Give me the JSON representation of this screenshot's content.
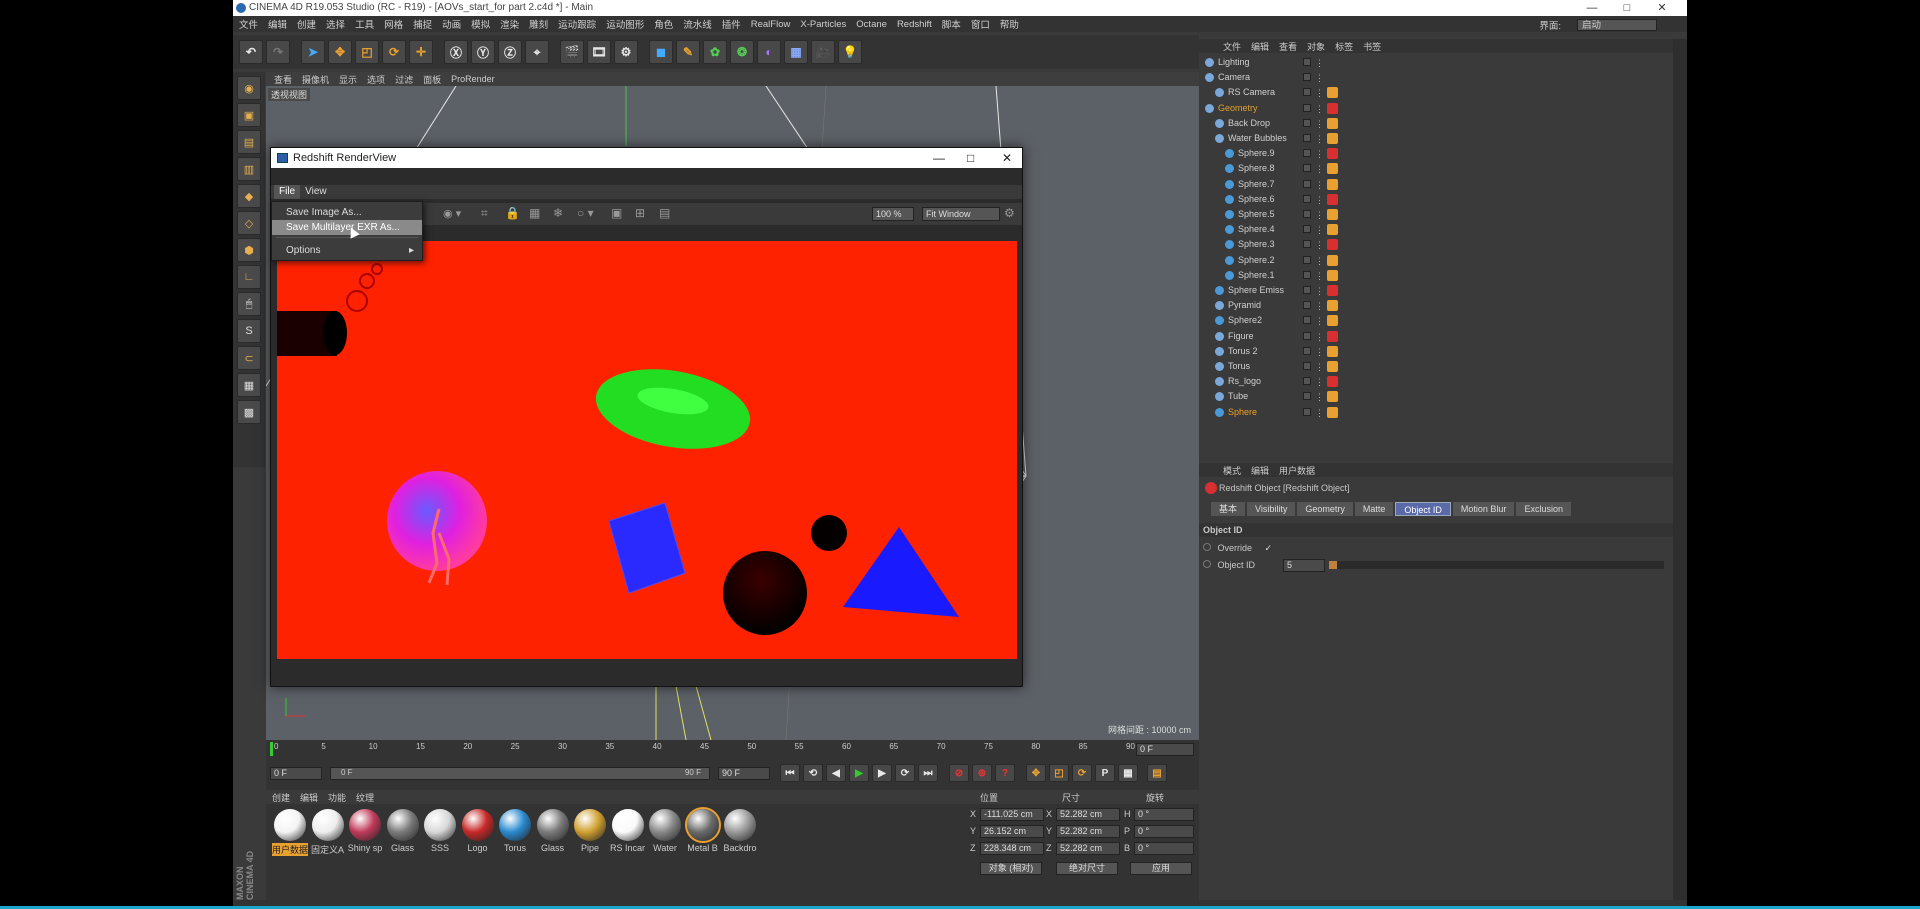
{
  "window": {
    "title": "CINEMA 4D R19.053 Studio (RC - R19) - [AOVs_start_for part 2.c4d *] - Main",
    "controls": [
      "—",
      "□",
      "✕"
    ]
  },
  "menubar": {
    "items": [
      "文件",
      "编辑",
      "创建",
      "选择",
      "工具",
      "网格",
      "捕捉",
      "动画",
      "模拟",
      "渲染",
      "雕刻",
      "运动跟踪",
      "运动图形",
      "角色",
      "流水线",
      "插件",
      "RealFlow",
      "X-Particles",
      "Octane",
      "Redshift",
      "脚本",
      "窗口",
      "帮助"
    ],
    "layout_label": "界面:",
    "layout_value": "启动"
  },
  "viewport": {
    "menu": [
      "查看",
      "摄像机",
      "显示",
      "选项",
      "过滤",
      "面板",
      "ProRender"
    ],
    "label": "透视视图",
    "grid_info": "网格间距 : 10000 cm"
  },
  "renderview": {
    "title": "Redshift RenderView",
    "menu": [
      "File",
      "View"
    ],
    "zoom": "100 %",
    "fit": "Fit Window",
    "file_menu": {
      "items": [
        "Save Image As...",
        "Save Multilayer EXR As...",
        "Options"
      ],
      "highlighted": "Save Multilayer EXR As...",
      "options_arrow": "▸"
    }
  },
  "timeline": {
    "ticks": [
      "0",
      "5",
      "10",
      "15",
      "20",
      "25",
      "30",
      "35",
      "40",
      "45",
      "50",
      "55",
      "60",
      "65",
      "70",
      "75",
      "80",
      "85",
      "90"
    ],
    "current_frame": "0 F",
    "start": "0 F",
    "range_start": "0 F",
    "range_end": "90 F",
    "end": "90 F"
  },
  "materials": {
    "tabs": [
      "创建",
      "编辑",
      "功能",
      "纹理"
    ],
    "items": [
      {
        "label": "用户数据",
        "color": "#f4f4f4"
      },
      {
        "label": "固定义A",
        "color": "#eeeeee"
      },
      {
        "label": "Shiny sp",
        "color": "#c03a5a"
      },
      {
        "label": "Glass",
        "color": "#7a7a7a"
      },
      {
        "label": "SSS",
        "color": "#d8d8d8"
      },
      {
        "label": "Logo",
        "color": "#c82828"
      },
      {
        "label": "Torus",
        "color": "#2a8ad0"
      },
      {
        "label": "Glass",
        "color": "#7a7a7a"
      },
      {
        "label": "Pipe",
        "color": "#d0a030"
      },
      {
        "label": "RS Incar",
        "color": "#fafafa"
      },
      {
        "label": "Water",
        "color": "#888888"
      },
      {
        "label": "Metal B",
        "color": "#6a6a6a"
      },
      {
        "label": "Backdro",
        "color": "#9a9a9a"
      }
    ]
  },
  "coords": {
    "headers": [
      "位置",
      "尺寸",
      "旋转"
    ],
    "rows": [
      {
        "axis": "X",
        "pos": "-111.025 cm",
        "size": "52.282 cm",
        "rot_label": "H",
        "rot": "0 °"
      },
      {
        "axis": "Y",
        "pos": "26.152 cm",
        "size": "52.282 cm",
        "rot_label": "P",
        "rot": "0 °"
      },
      {
        "axis": "Z",
        "pos": "228.348 cm",
        "size": "52.282 cm",
        "rot_label": "B",
        "rot": "0 °"
      }
    ],
    "mode": "对象 (相对)",
    "size_mode": "绝对尺寸",
    "apply": "应用"
  },
  "objects": {
    "menu": [
      "文件",
      "编辑",
      "查看",
      "对象",
      "标签",
      "书签"
    ],
    "rows": [
      {
        "name": "Lighting",
        "indent": 0,
        "color": "#d0d0d0"
      },
      {
        "name": "Camera",
        "indent": 0,
        "color": "#d0d0d0"
      },
      {
        "name": "RS Camera",
        "indent": 1,
        "color": "#d0d0d0"
      },
      {
        "name": "Geometry",
        "indent": 0,
        "color": "#e0a030"
      },
      {
        "name": "Back Drop",
        "indent": 1,
        "color": "#d0d0d0"
      },
      {
        "name": "Water Bubbles",
        "indent": 1,
        "color": "#d0d0d0"
      },
      {
        "name": "Sphere.9",
        "indent": 2,
        "color": "#d0d0d0"
      },
      {
        "name": "Sphere.8",
        "indent": 2,
        "color": "#d0d0d0"
      },
      {
        "name": "Sphere.7",
        "indent": 2,
        "color": "#d0d0d0"
      },
      {
        "name": "Sphere.6",
        "indent": 2,
        "color": "#d0d0d0"
      },
      {
        "name": "Sphere.5",
        "indent": 2,
        "color": "#d0d0d0"
      },
      {
        "name": "Sphere.4",
        "indent": 2,
        "color": "#d0d0d0"
      },
      {
        "name": "Sphere.3",
        "indent": 2,
        "color": "#d0d0d0"
      },
      {
        "name": "Sphere.2",
        "indent": 2,
        "color": "#d0d0d0"
      },
      {
        "name": "Sphere.1",
        "indent": 2,
        "color": "#d0d0d0"
      },
      {
        "name": "Sphere Emiss",
        "indent": 1,
        "color": "#d0d0d0"
      },
      {
        "name": "Pyramid",
        "indent": 1,
        "color": "#d0d0d0"
      },
      {
        "name": "Sphere2",
        "indent": 1,
        "color": "#d0d0d0"
      },
      {
        "name": "Figure",
        "indent": 1,
        "color": "#d0d0d0"
      },
      {
        "name": "Torus 2",
        "indent": 1,
        "color": "#d0d0d0"
      },
      {
        "name": "Torus",
        "indent": 1,
        "color": "#d0d0d0"
      },
      {
        "name": "Rs_logo",
        "indent": 1,
        "color": "#d0d0d0"
      },
      {
        "name": "Tube",
        "indent": 1,
        "color": "#d0d0d0"
      },
      {
        "name": "Sphere",
        "indent": 1,
        "color": "#f0a020"
      }
    ]
  },
  "attributes": {
    "menu": [
      "模式",
      "编辑",
      "用户数据"
    ],
    "object_title": "Redshift Object [Redshift Object]",
    "tabs": [
      "基本",
      "Visibility",
      "Geometry",
      "Matte",
      "Object ID",
      "Motion Blur",
      "Exclusion"
    ],
    "active_tab": "Object ID",
    "section": "Object ID",
    "override_label": "Override",
    "override_check": "✓",
    "objectid_label": "Object ID",
    "objectid_value": "5"
  },
  "branding": "MAXON CINEMA 4D"
}
